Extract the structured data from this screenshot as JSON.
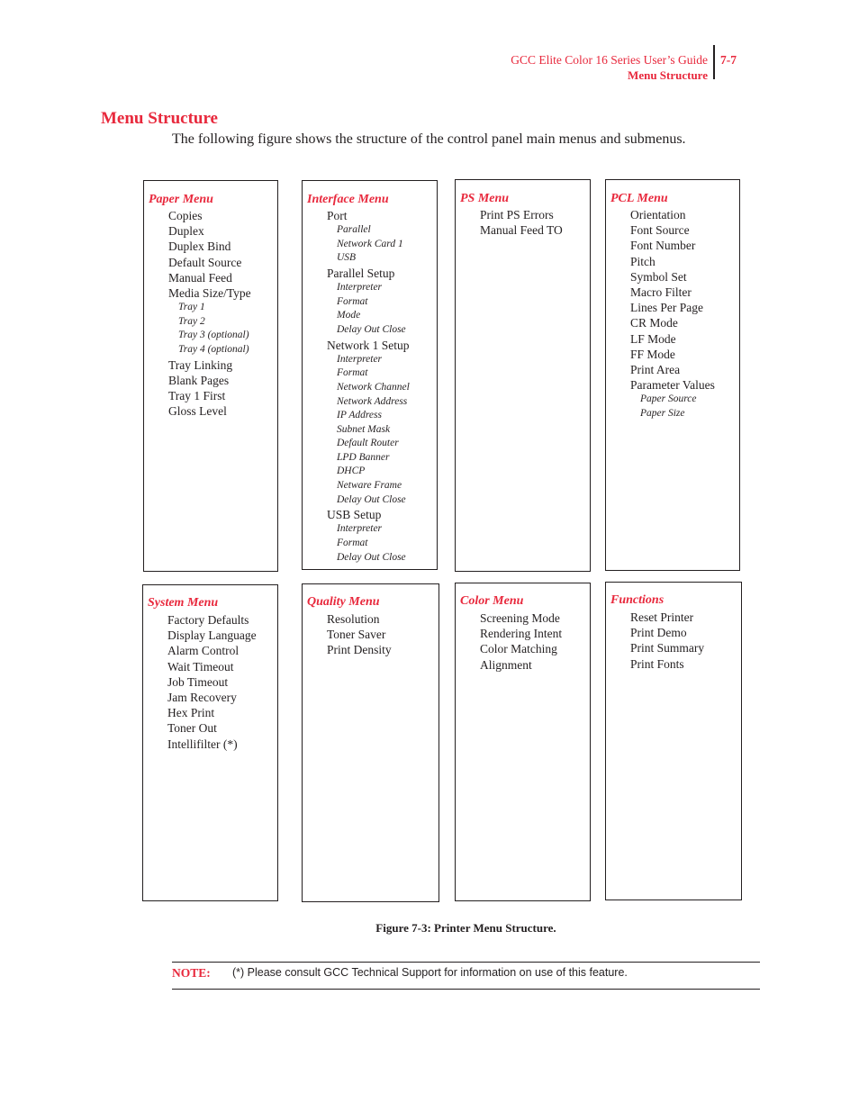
{
  "header": {
    "guide_title": "GCC Elite Color 16 Series User’s Guide",
    "section": "Menu Structure",
    "page_number": "7-7"
  },
  "section_title": "Menu Structure",
  "intro": "The following figure shows the structure of the control panel main menus and submenus.",
  "menus": [
    {
      "title": "Paper Menu",
      "items": [
        {
          "label": "Copies",
          "level": 1
        },
        {
          "label": "Duplex",
          "level": 1
        },
        {
          "label": "Duplex Bind",
          "level": 1
        },
        {
          "label": "Default Source",
          "level": 1
        },
        {
          "label": "Manual Feed",
          "level": 1
        },
        {
          "label": "Media Size/Type",
          "level": 1
        },
        {
          "label": "Tray 1",
          "level": 2
        },
        {
          "label": "Tray 2",
          "level": 2
        },
        {
          "label": "Tray 3 (optional)",
          "level": 2
        },
        {
          "label": "Tray 4 (optional)",
          "level": 2
        },
        {
          "label": "Tray Linking",
          "level": 1
        },
        {
          "label": "Blank Pages",
          "level": 1
        },
        {
          "label": "Tray 1 First",
          "level": 1
        },
        {
          "label": "Gloss Level",
          "level": 1
        }
      ]
    },
    {
      "title": "Interface Menu",
      "items": [
        {
          "label": "Port",
          "level": 1
        },
        {
          "label": "Parallel",
          "level": 2
        },
        {
          "label": "Network Card 1",
          "level": 2
        },
        {
          "label": "USB",
          "level": 2
        },
        {
          "label": "Parallel Setup",
          "level": 1
        },
        {
          "label": "Interpreter",
          "level": 2
        },
        {
          "label": "Format",
          "level": 2
        },
        {
          "label": "Mode",
          "level": 2
        },
        {
          "label": "Delay Out Close",
          "level": 2
        },
        {
          "label": "Network 1 Setup",
          "level": 1
        },
        {
          "label": "Interpreter",
          "level": 2
        },
        {
          "label": "Format",
          "level": 2
        },
        {
          "label": "Network Channel",
          "level": 2
        },
        {
          "label": "Network Address",
          "level": 2
        },
        {
          "label": "IP Address",
          "level": 2
        },
        {
          "label": "Subnet Mask",
          "level": 2
        },
        {
          "label": "Default Router",
          "level": 2
        },
        {
          "label": "LPD Banner",
          "level": 2
        },
        {
          "label": "DHCP",
          "level": 2
        },
        {
          "label": "Netware Frame",
          "level": 2
        },
        {
          "label": "Delay Out Close",
          "level": 2
        },
        {
          "label": "USB Setup",
          "level": 1
        },
        {
          "label": "Interpreter",
          "level": 2
        },
        {
          "label": "Format",
          "level": 2
        },
        {
          "label": "Delay Out Close",
          "level": 2
        }
      ]
    },
    {
      "title": "PS Menu",
      "items": [
        {
          "label": "Print PS Errors",
          "level": 1
        },
        {
          "label": "Manual Feed TO",
          "level": 1
        }
      ]
    },
    {
      "title": "PCL Menu",
      "items": [
        {
          "label": "Orientation",
          "level": 1
        },
        {
          "label": "Font Source",
          "level": 1
        },
        {
          "label": "Font Number",
          "level": 1
        },
        {
          "label": "Pitch",
          "level": 1
        },
        {
          "label": "Symbol Set",
          "level": 1
        },
        {
          "label": "Macro Filter",
          "level": 1
        },
        {
          "label": "Lines Per Page",
          "level": 1
        },
        {
          "label": "CR Mode",
          "level": 1
        },
        {
          "label": "LF Mode",
          "level": 1
        },
        {
          "label": "FF Mode",
          "level": 1
        },
        {
          "label": "Print Area",
          "level": 1
        },
        {
          "label": "Parameter Values",
          "level": 1
        },
        {
          "label": "Paper Source",
          "level": 2
        },
        {
          "label": "Paper Size",
          "level": 2
        }
      ]
    },
    {
      "title": "System Menu",
      "items": [
        {
          "label": "Factory Defaults",
          "level": 1
        },
        {
          "label": "Display Language",
          "level": 1
        },
        {
          "label": "Alarm Control",
          "level": 1
        },
        {
          "label": "Wait Timeout",
          "level": 1
        },
        {
          "label": "Job Timeout",
          "level": 1
        },
        {
          "label": "Jam Recovery",
          "level": 1
        },
        {
          "label": "Hex Print",
          "level": 1
        },
        {
          "label": "Toner Out",
          "level": 1
        },
        {
          "label": "Intellifilter (*)",
          "level": 1
        }
      ]
    },
    {
      "title": "Quality Menu",
      "items": [
        {
          "label": "Resolution",
          "level": 1
        },
        {
          "label": "Toner Saver",
          "level": 1
        },
        {
          "label": "Print Density",
          "level": 1
        }
      ]
    },
    {
      "title": "Color Menu",
      "items": [
        {
          "label": "Screening Mode",
          "level": 1
        },
        {
          "label": "Rendering Intent",
          "level": 1
        },
        {
          "label": "Color Matching",
          "level": 1
        },
        {
          "label": "Alignment",
          "level": 1
        }
      ]
    },
    {
      "title": "Functions",
      "items": [
        {
          "label": "Reset Printer",
          "level": 1
        },
        {
          "label": "Print Demo",
          "level": 1
        },
        {
          "label": "Print Summary",
          "level": 1
        },
        {
          "label": "Print Fonts",
          "level": 1
        }
      ]
    }
  ],
  "figure_caption": "Figure 7-3:  Printer Menu Structure.",
  "note": {
    "label": "NOTE:",
    "text": "(*) Please consult GCC Technical Support for information on use of this feature."
  },
  "colors": {
    "accent_red": "#e8283c",
    "text": "#231f20"
  }
}
